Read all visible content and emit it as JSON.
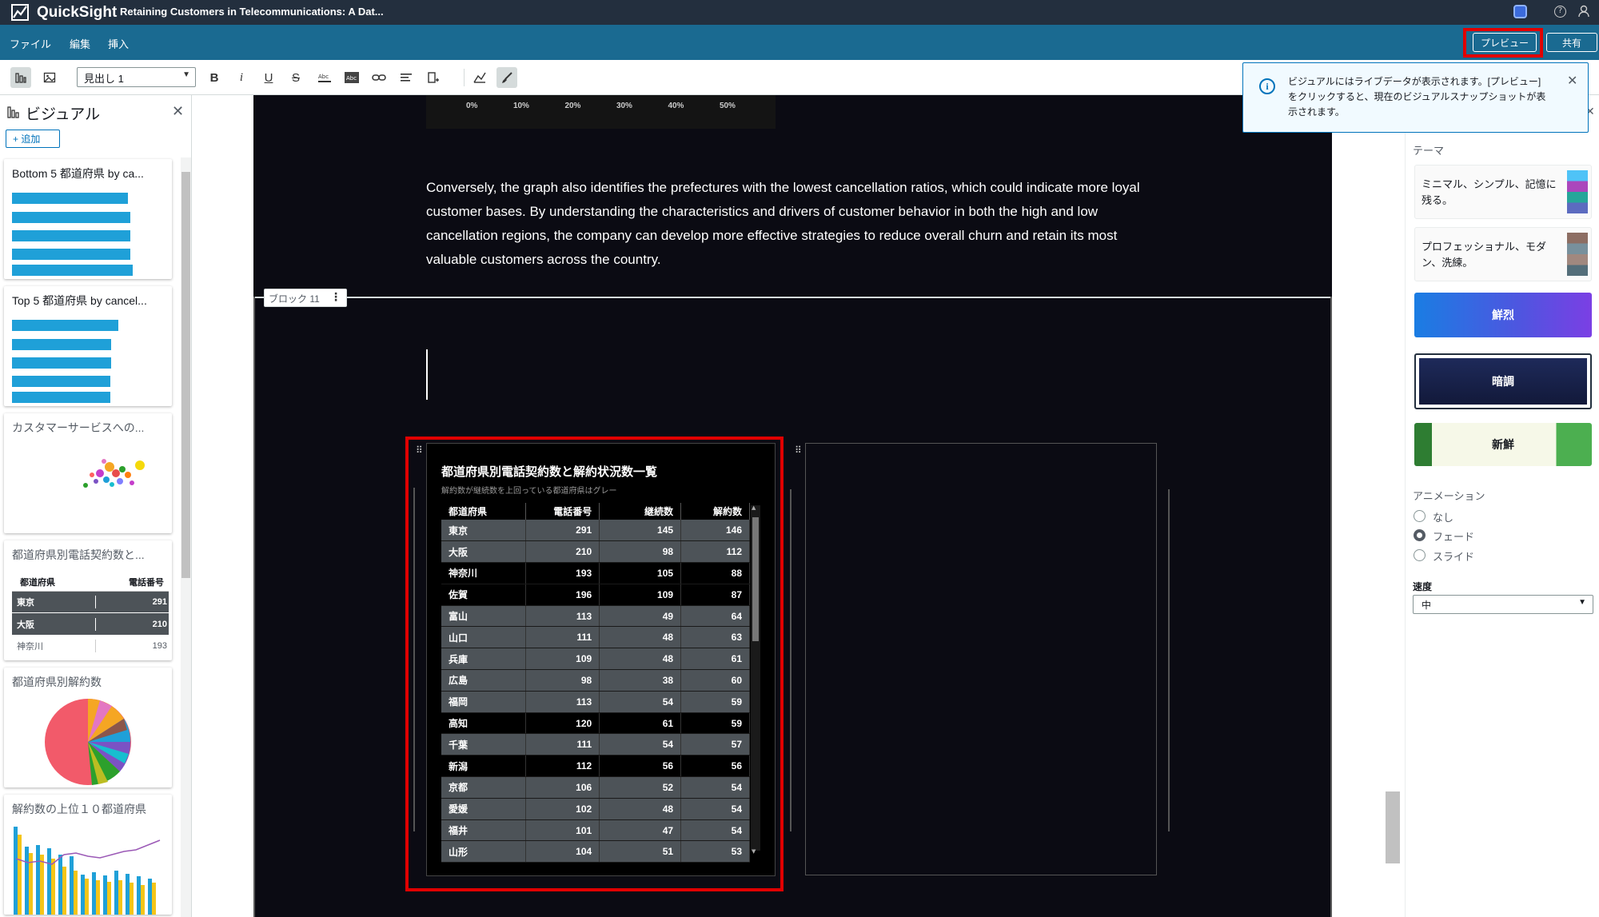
{
  "app": {
    "name": "QuickSight",
    "document_title": "Retaining Customers in Telecommunications: A Dat..."
  },
  "menu": {
    "file": "ファイル",
    "edit": "編集",
    "insert": "挿入",
    "preview": "プレビュー",
    "share": "共有"
  },
  "toolbar": {
    "style_value": "見出し 1",
    "bold": "B",
    "italic": "i",
    "underline": "U",
    "strike": "S"
  },
  "left_panel": {
    "title": "ビジュアル",
    "add_button": "追加",
    "cards": [
      {
        "title": "Bottom 5 都道府県 by ca..."
      },
      {
        "title": "Top 5 都道府県 by cancel..."
      },
      {
        "title": "カスタマーサービスへの..."
      },
      {
        "title": "都道府県別電話契約数と..."
      },
      {
        "title": "都道府県別解約数"
      },
      {
        "title": "解約数の上位１０都道府県"
      }
    ],
    "mini_table": {
      "headers": [
        "都道府県",
        "電話番号"
      ],
      "rows": [
        [
          "東京",
          "291"
        ],
        [
          "大阪",
          "210"
        ],
        [
          "神奈川",
          "193"
        ]
      ]
    }
  },
  "canvas": {
    "axis_ticks": [
      "0%",
      "10%",
      "20%",
      "30%",
      "40%",
      "50%"
    ],
    "paragraph": "Conversely, the graph also identifies the prefectures with the lowest cancellation ratios, which could indicate more loyal customer bases. By understanding the characteristics and drivers of customer behavior in both the high and low cancellation regions, the company can develop more effective strategies to reduce overall churn and retain its most valuable customers across the country.",
    "block_label": "ブロック 11",
    "table_visual": {
      "title": "都道府県別電話契約数と解約状況数一覧",
      "subtitle": "解約数が継続数を上回っている都道府県はグレー",
      "headers": [
        "都道府県",
        "電話番号",
        "継続数",
        "解約数"
      ],
      "rows": [
        [
          "東京",
          "291",
          "145",
          "146"
        ],
        [
          "大阪",
          "210",
          "98",
          "112"
        ],
        [
          "神奈川",
          "193",
          "105",
          "88"
        ],
        [
          "佐賀",
          "196",
          "109",
          "87"
        ],
        [
          "富山",
          "113",
          "49",
          "64"
        ],
        [
          "山口",
          "111",
          "48",
          "63"
        ],
        [
          "兵庫",
          "109",
          "48",
          "61"
        ],
        [
          "広島",
          "98",
          "38",
          "60"
        ],
        [
          "福岡",
          "113",
          "54",
          "59"
        ],
        [
          "高知",
          "120",
          "61",
          "59"
        ],
        [
          "千葉",
          "111",
          "54",
          "57"
        ],
        [
          "新潟",
          "112",
          "56",
          "56"
        ],
        [
          "京都",
          "106",
          "52",
          "54"
        ],
        [
          "愛媛",
          "102",
          "48",
          "54"
        ],
        [
          "福井",
          "101",
          "47",
          "54"
        ],
        [
          "山形",
          "104",
          "51",
          "53"
        ]
      ],
      "row_shading": [
        "g",
        "g",
        "b",
        "b",
        "g",
        "g",
        "g",
        "g",
        "g",
        "b",
        "g",
        "b",
        "g",
        "g",
        "g",
        "g"
      ]
    }
  },
  "toast": {
    "message": "ビジュアルにはライブデータが表示されます。[プレビュー] をクリックすると、現在のビジュアルスナップショットが表示されます。"
  },
  "right_panel": {
    "theme_label": "テーマ",
    "themes": [
      {
        "label": "ミニマル、シンプル、記憶に残る。"
      },
      {
        "label": "プロフェッショナル、モダン、洗練。"
      },
      {
        "label": "鮮烈"
      },
      {
        "label": "暗調"
      },
      {
        "label": "新鮮"
      }
    ],
    "animation_label": "アニメーション",
    "animation_options": [
      "なし",
      "フェード",
      "スライド"
    ],
    "animation_selected": "フェード",
    "speed_label": "速度",
    "speed_value": "中"
  },
  "colors": {
    "topbar": "#232f3e",
    "menubar": "#1a6a91",
    "canvas": "#0b0b13",
    "accent": "#0073bb",
    "bar_blue": "#1fa0d8",
    "highlight": "#e10000"
  }
}
